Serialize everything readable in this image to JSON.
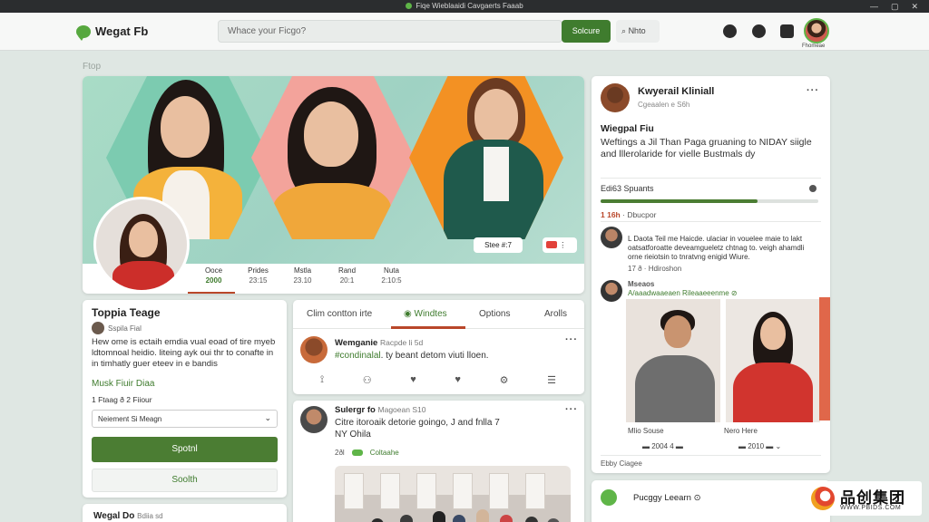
{
  "window": {
    "title": "Fiqe Wieblaaidi Cavgaerts Faaab",
    "controls": [
      "—",
      "▢",
      "✕"
    ]
  },
  "topbar": {
    "app_name": "Wegat Fb",
    "search_placeholder": "Whace your Ficgo?",
    "search_button": "Solcure",
    "secondary_button": "Nhto",
    "avatar_caption": "Fhomeae",
    "icons": [
      "bell-icon",
      "message-icon",
      "bookmark-icon"
    ]
  },
  "page_label": "Ftop",
  "hero": {
    "pill_label": "Stee #:7",
    "more_label": "⋮",
    "stats": [
      {
        "label": "Ooce",
        "value": "2000",
        "active": true
      },
      {
        "label": "Prides",
        "value": "23:15",
        "active": false
      },
      {
        "label": "Mstla",
        "value": "23.10",
        "active": false
      },
      {
        "label": "Rand",
        "value": "20:1",
        "active": false
      },
      {
        "label": "Nuta",
        "value": "2:10:5",
        "active": false
      }
    ]
  },
  "profile_card": {
    "name": "Toppia Teage",
    "subtitle": "Sspila Fial",
    "bio": "Hew ome is ectaih emdia vual eoad of tire myeb ldtomnoal heidio. liteing ayk oui thr to conafte in in timhatly guer eteev in e bandis",
    "link": "Musk Fiuir Diaa",
    "meta": "1 Ftaag ð 2 Fiiour",
    "select_value": "Neiement Si Meagn",
    "primary_button": "Spotnl",
    "secondary_button": "Soolth"
  },
  "profile_card_2": {
    "title": "Wegal Do",
    "subtitle": "Bdiia sd"
  },
  "tabs": {
    "items": [
      {
        "label": "Clim contton irte",
        "active": false
      },
      {
        "label": "Windtes",
        "active": true
      },
      {
        "label": "Options",
        "active": false
      },
      {
        "label": "Arolls",
        "active": false
      }
    ]
  },
  "post1": {
    "author": "Wemganie",
    "meta": "Racpde li 5d",
    "hashtag": "#condinalal",
    "text": ". ty beant detom viuti lloen."
  },
  "post2": {
    "author": "Sulergr fo",
    "meta": "Magoean S10",
    "text": "Citre itoroaik detorie goingo, J and fnlla 7",
    "subtext": "NY Ohila",
    "reply_count": "2ðl",
    "reply_label": "Coltaahe"
  },
  "right_panel": {
    "name": "Kwyerail Kliniall",
    "subtitle": "Cgeaalen e S6h",
    "title": "Wiegpal Fiu",
    "description": "Weftings a Jil Than Paga gruaning to NIDAY siigle and lllerolaride for vielle Bustmals dy",
    "progress_label": "Edi63 Spuants",
    "progress_value": 0.72,
    "count_number": "1 16h",
    "count_label": "Dbucpor",
    "comment1": {
      "text": "L Daota Teil me Haicde. ulaciar in vouelee maie to lakt oatsatforoatte deveamgueletz chtnag to. veigh ahamdli orne rieiotsin to tnratvng enigid Wiure.",
      "meta_count": "17 ð",
      "meta_label": "Hdiroshon"
    },
    "comment2": {
      "name": "Mseaos",
      "tag": "A/aaadwaaeaen Rileaaeeenme ⊘"
    },
    "people": [
      {
        "caption": "Mlio Souse",
        "stat": "2004 4"
      },
      {
        "caption": "Nero Here",
        "stat": "2010"
      }
    ],
    "footer": "Ebby Ciagee"
  },
  "right_panel_2": {
    "title": "Pucggy Leearn",
    "badge": "⊙"
  },
  "watermark": {
    "logo_text": "品创集团",
    "url": "WWW.PBIDS.COM"
  },
  "colors": {
    "accent": "#3f7c2e",
    "tab_underline": "#b9472a",
    "hex_teal": "#7ccbb0",
    "hex_pink": "#f3a39b",
    "hex_orange": "#f39123"
  }
}
